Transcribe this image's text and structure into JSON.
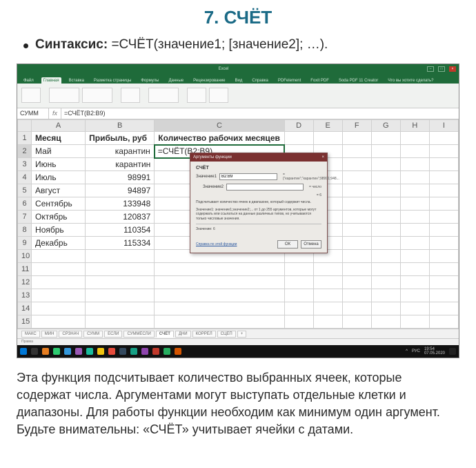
{
  "title": "7. СЧЁТ",
  "syntax": {
    "label": "Синтаксис:",
    "value": "=СЧЁТ(значение1; [значение2]; …)."
  },
  "excel_titlebar": {
    "left": "",
    "center": "Excel",
    "right_user": ""
  },
  "ribbon_tabs": [
    "Файл",
    "Главная",
    "Вставка",
    "Разметка страницы",
    "Формулы",
    "Данные",
    "Рецензирование",
    "Вид",
    "Справка",
    "PDFelement",
    "Foxit PDF",
    "Soda PDF 11 Creator",
    "Что вы хотите сделать?"
  ],
  "ribbon_active_index": 1,
  "namebox": "СУММ",
  "formula_bar": "=СЧЁТ(B2:B9)",
  "columns": [
    "A",
    "B",
    "C",
    "D",
    "E",
    "F",
    "G",
    "H",
    "I"
  ],
  "selected_col_index": 2,
  "rows": [
    {
      "n": "1",
      "A": "Месяц",
      "B": "Прибыль, руб",
      "C": "Количество рабочих месяцев",
      "bold": true
    },
    {
      "n": "2",
      "A": "Май",
      "B": "карантин",
      "C": "=СЧЁТ(B2:B9)",
      "B_align": "right",
      "formula": true,
      "sel": true
    },
    {
      "n": "3",
      "A": "Июнь",
      "B": "карантин",
      "B_align": "right"
    },
    {
      "n": "4",
      "A": "Июль",
      "B": "98991",
      "B_align": "right"
    },
    {
      "n": "5",
      "A": "Август",
      "B": "94897",
      "B_align": "right"
    },
    {
      "n": "6",
      "A": "Сентябрь",
      "B": "133948",
      "B_align": "right"
    },
    {
      "n": "7",
      "A": "Октябрь",
      "B": "120837",
      "B_align": "right"
    },
    {
      "n": "8",
      "A": "Ноябрь",
      "B": "110354",
      "B_align": "right"
    },
    {
      "n": "9",
      "A": "Декабрь",
      "B": "115334",
      "B_align": "right"
    },
    {
      "n": "10"
    },
    {
      "n": "11"
    },
    {
      "n": "12"
    },
    {
      "n": "13"
    },
    {
      "n": "14"
    },
    {
      "n": "15"
    }
  ],
  "dialog": {
    "title": "Аргументы функции",
    "fn_name": "СЧЁТ",
    "arg1_label": "Значение1",
    "arg1_value": "B2:B9",
    "arg1_hint": "= {\"карантин\";\"карантин\";98991;948...",
    "arg2_label": "Значение2",
    "arg2_value": "",
    "arg2_hint": "= число",
    "result_hint": "= 6",
    "desc1": "Подсчитывает количество ячеек в диапазоне, который содержит числа.",
    "desc2": "Значение1: значение1;значение2;... от 1 до 255 аргументов, которые могут содержать или ссылаться на данные различных типов, но учитываются только числовые значения.",
    "result_label": "Значение: 6",
    "help_link": "Справка по этой функции",
    "ok": "ОК",
    "cancel": "Отмена"
  },
  "sheet_tabs": [
    "МАКС",
    "МИН",
    "СРЗНАЧ",
    "СУММ",
    "ЕСЛИ",
    "СУММЕСЛИ",
    "СЧЁТ",
    "ДНИ",
    "КОРРЕЛ",
    "СЦЕП"
  ],
  "active_sheet_index": 6,
  "status_bar": "Правка",
  "taskbar_time": "19:54",
  "taskbar_date": "07.05.2020",
  "taskbar_lang": "РУС",
  "description": "Эта функция подсчитывает количество выбранных ячеек, которые содержат числа. Аргументами могут выступать отдельные клетки и диапазоны. Для работы функции необходим как минимум один аргумент. Будьте внимательны: «СЧЁТ» учитывает ячейки с датами."
}
